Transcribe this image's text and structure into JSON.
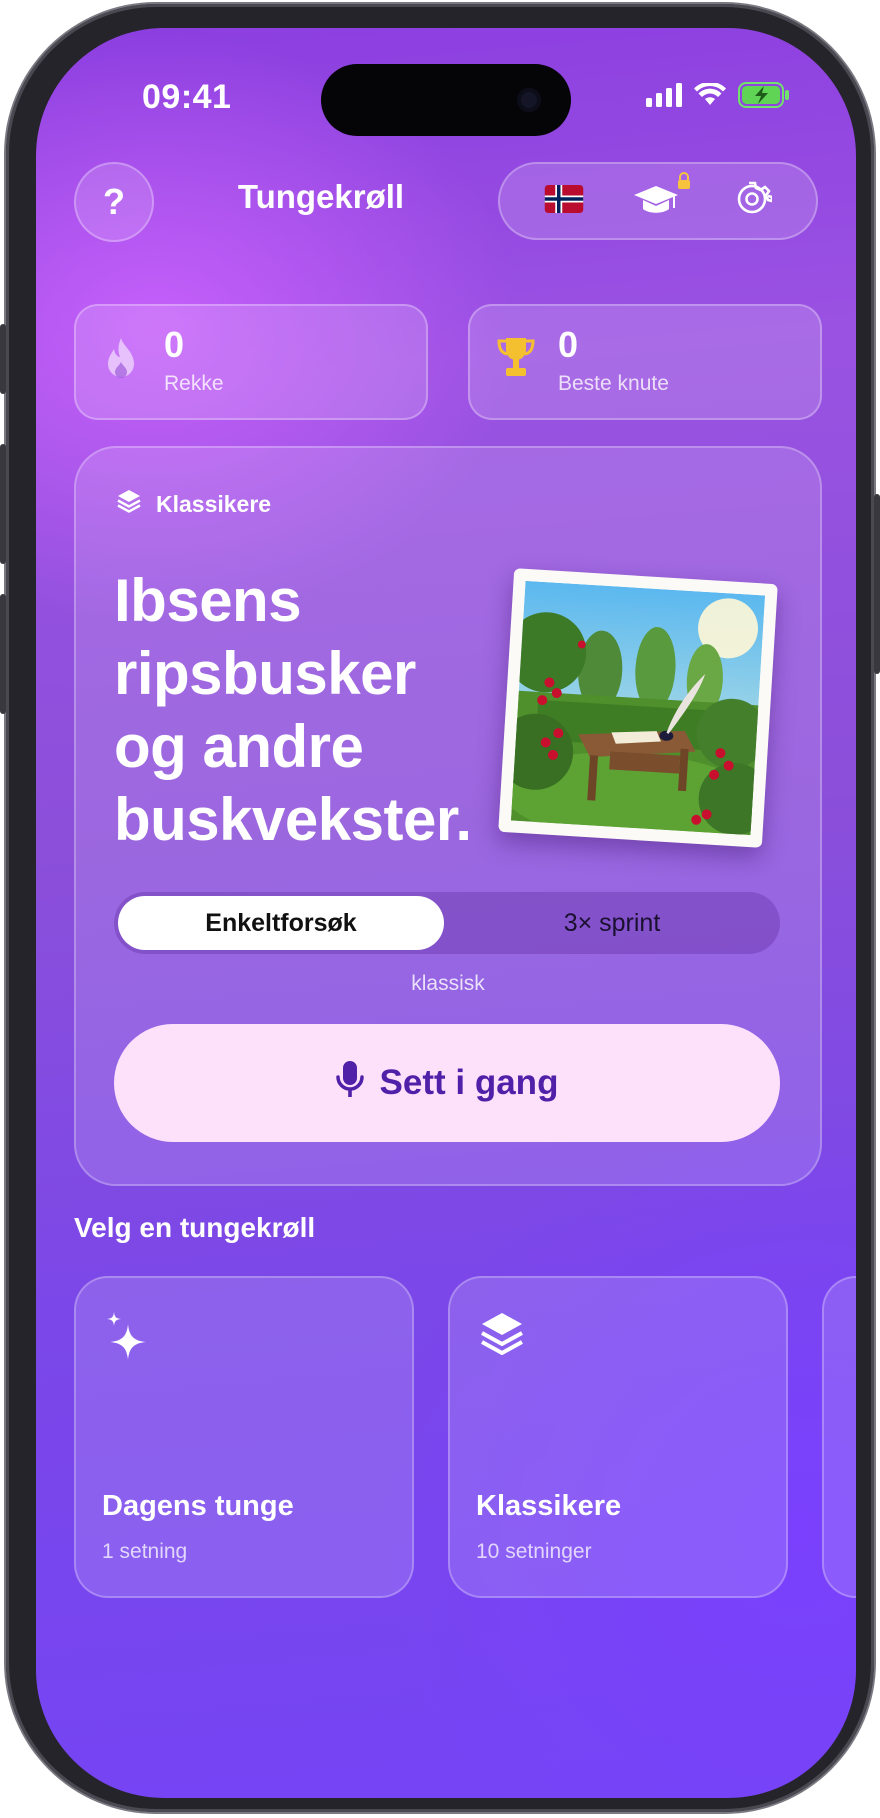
{
  "status_bar": {
    "time": "09:41"
  },
  "header": {
    "help_label": "?",
    "title": "Tungekrøll",
    "icons": [
      "norway-flag-icon",
      "graduation-cap-icon",
      "lock-icon",
      "gear-icon"
    ]
  },
  "stats": [
    {
      "value": "0",
      "label": "Rekke",
      "icon": "flame-icon"
    },
    {
      "value": "0",
      "label": "Beste knute",
      "icon": "trophy-icon"
    }
  ],
  "hero": {
    "category": "Klassikere",
    "title": "Ibsens ripsbusker og andre buskvekster.",
    "segments": [
      "Enkeltforsøk",
      "3× sprint"
    ],
    "selected_segment": "Enkeltforsøk",
    "mode_label": "klassisk",
    "start_label": "Sett i gang"
  },
  "section": {
    "title": "Velg en tungekrøll"
  },
  "cards": [
    {
      "title": "Dagens tunge",
      "subtitle": "1 setning",
      "icon": "sparkles-icon"
    },
    {
      "title": "Klassikere",
      "subtitle": "10 setninger",
      "icon": "layers-icon"
    }
  ],
  "colors": {
    "accent": "#5120a8",
    "button_bg": "#fde1fb",
    "trophy": "#f5c030"
  }
}
